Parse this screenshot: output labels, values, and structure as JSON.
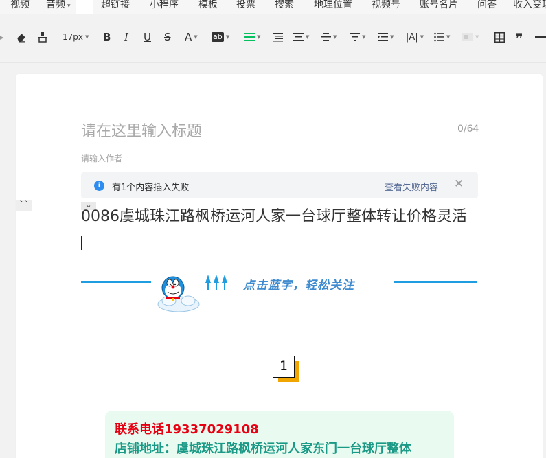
{
  "menu": {
    "items": [
      "视频",
      "音频",
      "超链接",
      "小程序",
      "模板",
      "投票",
      "搜索",
      "地理位置",
      "视频号",
      "账号名片",
      "问答",
      "收入变现"
    ]
  },
  "toolbar": {
    "font_size": "17px",
    "buttons": [
      "eraser-icon",
      "format-painter-icon",
      "bold-icon",
      "italic-icon",
      "underline-icon",
      "strikethrough-icon",
      "font-color-icon",
      "background-color-icon",
      "align-icon",
      "indent-icon",
      "line-height-icon",
      "paragraph-spacing-icon",
      "letter-spacing-icon",
      "list-icon",
      "table-icon",
      "quote-icon",
      "divider-icon"
    ],
    "accent_color": "#07c160"
  },
  "editor": {
    "title_placeholder": "请在这里输入标题",
    "title_count": "0/64",
    "author_placeholder": "请输入作者",
    "notice": {
      "message": "有1个内容插入失败",
      "link": "查看失败内容"
    },
    "left_glyph": "``",
    "body_line": "0086虞城珠江路枫桥运河人家一台球厅整体转让价格灵活",
    "banner_text": "点击蓝字，轻松关注",
    "section_number": "1",
    "contact_phone": "联系电话19337029108",
    "contact_address": "店铺地址：虞城珠江路枫桥运河人家东门一台球厅整体"
  },
  "colors": {
    "link": "#576b95",
    "info": "#2d8cf0",
    "banner_blue": "#1e9de0",
    "phone_red": "#e60012",
    "address_teal": "#1a9a86",
    "contact_bg": "#e9fbf0",
    "badge_shadow": "#f0a500"
  }
}
